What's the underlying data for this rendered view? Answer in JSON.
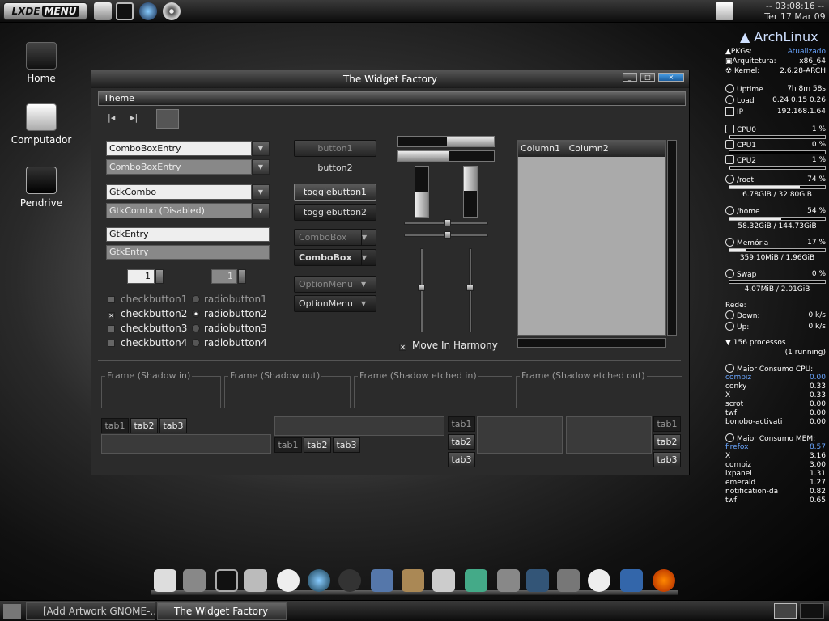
{
  "top_panel": {
    "menu_label_a": "LXDE",
    "menu_label_b": "MENU",
    "clock_time": "-- 03:08:16 --",
    "clock_date": "Ter 17 Mar 09"
  },
  "desktop": {
    "icons": [
      "Home",
      "Computador",
      "Pendrive"
    ]
  },
  "window": {
    "title": "The Widget Factory",
    "menu": "Theme",
    "combos": [
      "ComboBoxEntry",
      "ComboBoxEntry",
      "GtkCombo",
      "GtkCombo (Disabled)"
    ],
    "entries": [
      "GtkEntry",
      "GtkEntry"
    ],
    "spins": [
      "1",
      "1"
    ],
    "checks": [
      "checkbutton1",
      "checkbutton2",
      "checkbutton3",
      "checkbutton4"
    ],
    "radios": [
      "radiobutton1",
      "radiobutton2",
      "radiobutton3",
      "radiobutton4"
    ],
    "buttons": [
      "button1",
      "button2",
      "togglebutton1",
      "togglebutton2",
      "ComboBox",
      "ComboBox",
      "OptionMenu",
      "OptionMenu"
    ],
    "harmony": "Move In Harmony",
    "columns": [
      "Column1",
      "Column2"
    ],
    "frames": [
      "Frame (Shadow in)",
      "Frame (Shadow out)",
      "Frame (Shadow etched in)",
      "Frame (Shadow etched out)"
    ],
    "tabs": [
      "tab1",
      "tab2",
      "tab3"
    ]
  },
  "conky": {
    "brand": "ArchLinux",
    "pkgs": "PKGs:",
    "pkgs_val": "Atualizado",
    "arch": "Arquitetura:",
    "arch_val": "x86_64",
    "kernel": "Kernel:",
    "kernel_val": "2.6.28-ARCH",
    "uptime": "Uptime",
    "uptime_val": "7h 8m 58s",
    "load": "Load",
    "load_val": "0.24 0.15 0.26",
    "ip": "IP",
    "ip_val": "192.168.1.64",
    "cpus": [
      {
        "label": "CPU0",
        "value": "1 %",
        "level": 1
      },
      {
        "label": "CPU1",
        "value": "0 %",
        "level": 0
      },
      {
        "label": "CPU2",
        "value": "1 %",
        "level": 1
      }
    ],
    "disks": [
      {
        "label": "/root",
        "pct": "74 %",
        "level": 74,
        "size": "6.78GiB  / 32.80GiB"
      },
      {
        "label": "/home",
        "pct": "54 %",
        "level": 54,
        "size": "58.32GiB  / 144.73GiB"
      },
      {
        "label": "Memória",
        "pct": "17 %",
        "level": 17,
        "size": "359.10MiB / 1.96GiB"
      },
      {
        "label": "Swap",
        "pct": "0 %",
        "level": 0,
        "size": "4.07MiB  / 2.01GiB"
      }
    ],
    "net": "Rede:",
    "down": "Down:",
    "down_val": "0   k/s",
    "up": "Up:",
    "up_val": "0   k/s",
    "procs": "156  processos",
    "running": "(1  running)",
    "cpu_title": "Maior Consumo CPU:",
    "cpu_top": [
      [
        "compiz",
        "0.00"
      ],
      [
        "conky",
        "0.33"
      ],
      [
        "X",
        "0.33"
      ],
      [
        "scrot",
        "0.00"
      ],
      [
        "twf",
        "0.00"
      ],
      [
        "bonobo-activati",
        "0.00"
      ]
    ],
    "mem_title": "Maior Consumo MEM:",
    "mem_top": [
      [
        "firefox",
        "8.57"
      ],
      [
        "X",
        "3.16"
      ],
      [
        "compiz",
        "3.00"
      ],
      [
        "lxpanel",
        "1.31"
      ],
      [
        "emerald",
        "1.27"
      ],
      [
        "notification-da",
        "0.82"
      ],
      [
        "twf",
        "0.65"
      ]
    ]
  },
  "taskbar": [
    "[Add Artwork GNOME-...",
    "The Widget Factory"
  ]
}
